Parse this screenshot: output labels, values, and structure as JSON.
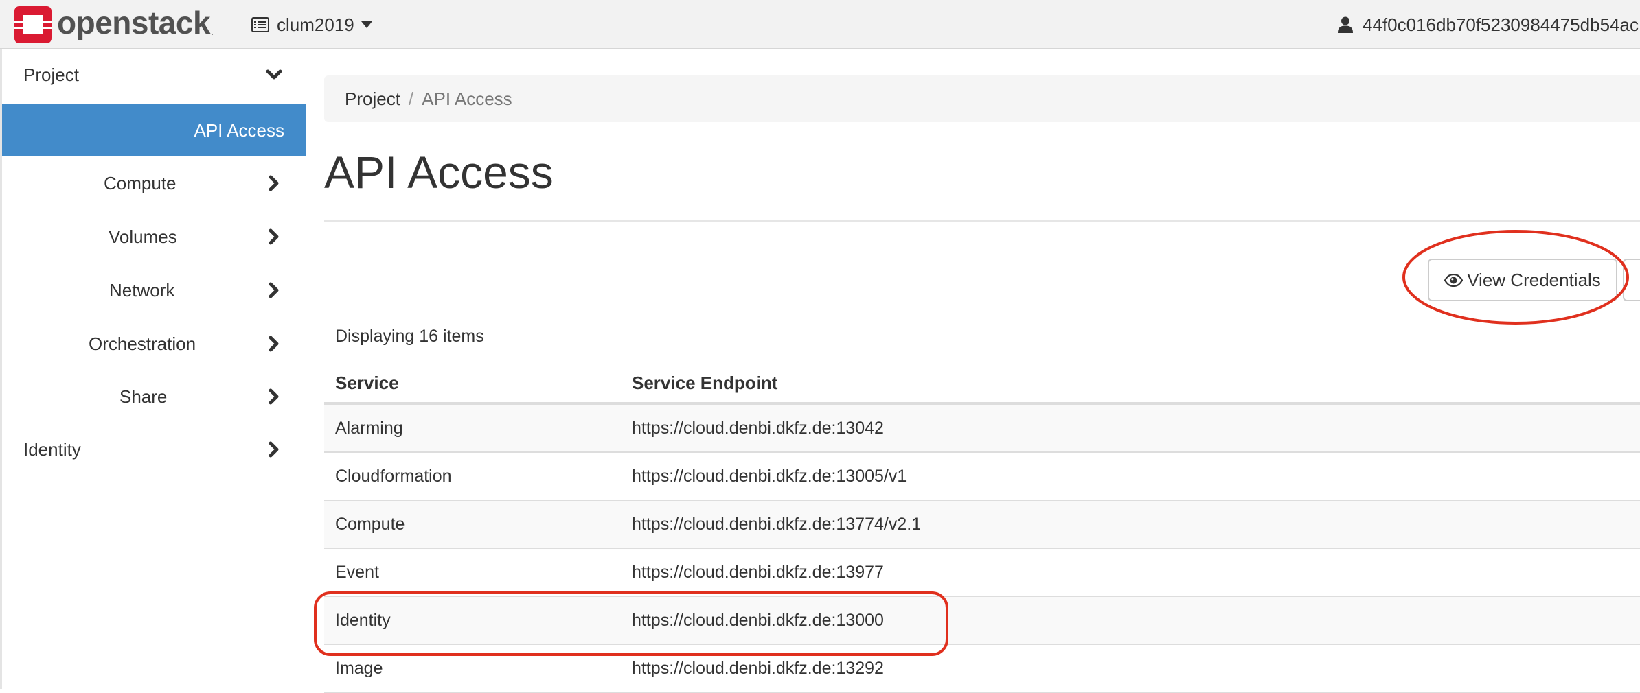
{
  "navbar": {
    "brand": "openstack",
    "brand_mark": ".",
    "project": "clum2019",
    "user": "44f0c016db70f5230984475db54ac"
  },
  "sidebar": {
    "items": [
      {
        "label": "Project",
        "level": "top",
        "state": "expanded"
      },
      {
        "label": "API Access",
        "level": "sub",
        "state": "active"
      },
      {
        "label": "Compute",
        "level": "sub",
        "state": "collapsed"
      },
      {
        "label": "Volumes",
        "level": "sub",
        "state": "collapsed"
      },
      {
        "label": "Network",
        "level": "sub",
        "state": "collapsed"
      },
      {
        "label": "Orchestration",
        "level": "sub",
        "state": "collapsed"
      },
      {
        "label": "Share",
        "level": "sub",
        "state": "collapsed"
      },
      {
        "label": "Identity",
        "level": "top",
        "state": "collapsed"
      }
    ]
  },
  "breadcrumb": {
    "items": [
      "Project",
      "API Access"
    ],
    "separator": "/"
  },
  "page": {
    "title": "API Access"
  },
  "actions": {
    "view_credentials": "View Credentials"
  },
  "table": {
    "count_text": "Displaying 16 items",
    "headers": [
      "Service",
      "Service Endpoint"
    ],
    "rows": [
      [
        "Alarming",
        "https://cloud.denbi.dkfz.de:13042"
      ],
      [
        "Cloudformation",
        "https://cloud.denbi.dkfz.de:13005/v1"
      ],
      [
        "Compute",
        "https://cloud.denbi.dkfz.de:13774/v2.1"
      ],
      [
        "Event",
        "https://cloud.denbi.dkfz.de:13977"
      ],
      [
        "Identity",
        "https://cloud.denbi.dkfz.de:13000"
      ],
      [
        "Image",
        "https://cloud.denbi.dkfz.de:13292"
      ]
    ]
  },
  "colors": {
    "brand_red": "#da1a32",
    "active_blue": "#428bca",
    "annotation_red": "#e0301e"
  }
}
